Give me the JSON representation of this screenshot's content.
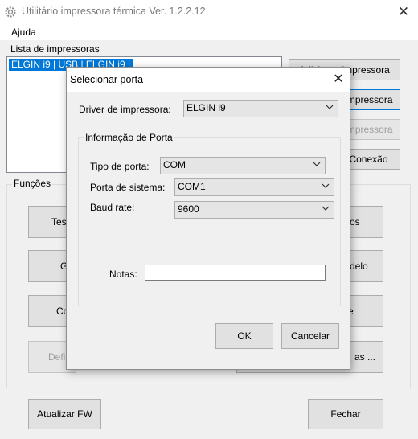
{
  "window": {
    "title": "Utilitário impressora térmica Ver. 1.2.2.12",
    "close_glyph": "✕"
  },
  "menu": {
    "items": [
      "Ajuda"
    ]
  },
  "printers": {
    "label": "Lista de impressoras",
    "items": [
      "ELGIN i9 | USB | ELGIN i9 |"
    ],
    "buttons": {
      "add": "Adicionar impressora",
      "edit": "Impressora",
      "remove": "Impressora",
      "connection": "Conexão"
    }
  },
  "functions": {
    "label": "Funções",
    "left_buttons": [
      "Tes",
      "G",
      "Co",
      "Defi"
    ],
    "right_buttons": [
      "os",
      "delo",
      "e",
      "as ..."
    ]
  },
  "footer": {
    "update_fw": "Atualizar FW",
    "close": "Fechar"
  },
  "dialog": {
    "title": "Selecionar porta",
    "close_glyph": "✕",
    "driver": {
      "label": "Driver de impressora:",
      "value": "ELGIN i9"
    },
    "port_info": {
      "label": "Informação de Porta",
      "port_type": {
        "label": "Tipo de porta:",
        "value": "COM"
      },
      "system_port": {
        "label": "Porta de sistema:",
        "value": "COM1"
      },
      "baud_rate": {
        "label": "Baud rate:",
        "value": "9600"
      },
      "notes": {
        "label": "Notas:",
        "value": ""
      }
    },
    "ok": "OK",
    "cancel": "Cancelar"
  }
}
